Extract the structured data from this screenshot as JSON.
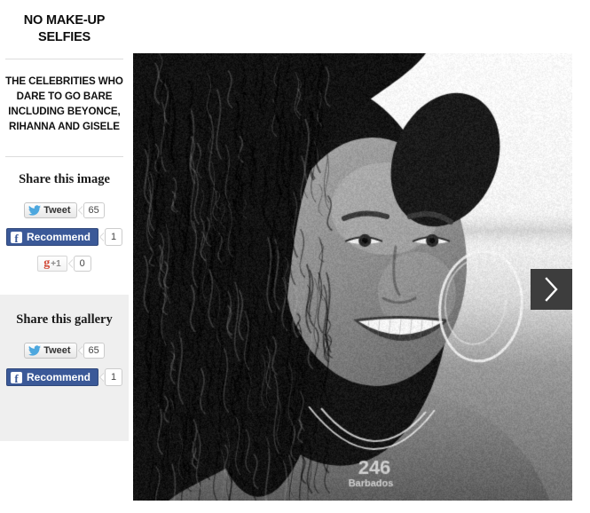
{
  "sidebar": {
    "headline": "NO MAKE-UP SELFIES",
    "standfirst": "THE CELEBRITIES WHO DARE TO GO BARE INCLUDING BEYONCE, RIHANNA AND GISELE",
    "share_image": {
      "title": "Share this image",
      "tweet": {
        "label": "Tweet",
        "count": "65",
        "icon": "twitter-bird-icon"
      },
      "facebook": {
        "label": "Recommend",
        "count": "1",
        "icon": "facebook-f-icon"
      },
      "googleplus": {
        "label_g": "g",
        "label_plus": "+1",
        "count": "0",
        "icon": "google-plus-icon"
      }
    },
    "share_gallery": {
      "title": "Share this gallery",
      "tweet": {
        "label": "Tweet",
        "count": "65",
        "icon": "twitter-bird-icon"
      },
      "facebook": {
        "label": "Recommend",
        "count": "1",
        "icon": "facebook-f-icon"
      }
    }
  },
  "gallery": {
    "photo": {
      "description": "Black and white portrait photograph of a smiling woman with long curly hair, large hoop earrings and a pendant necklace, beach in background",
      "pendant_text": "246 Barbados",
      "alt": "Rihanna no make-up selfie"
    },
    "next_button": {
      "icon": "chevron-right-icon",
      "label": "Next image"
    }
  },
  "colors": {
    "facebook_blue": "#3b5998",
    "twitter_blue": "#1da1f2",
    "googleplus_red": "#d14836",
    "panel_gray": "#efefef",
    "next_button_gray": "#3d3d3d"
  }
}
